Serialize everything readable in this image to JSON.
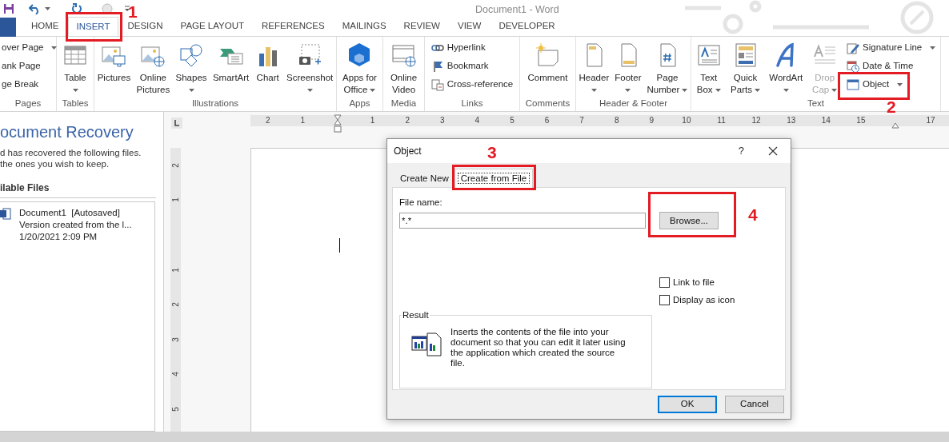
{
  "title_bar": {
    "title": "Document1 - Word"
  },
  "tabs": [
    {
      "label": "HOME",
      "selected": false
    },
    {
      "label": "INSERT",
      "selected": true
    },
    {
      "label": "DESIGN",
      "selected": false
    },
    {
      "label": "PAGE LAYOUT",
      "selected": false
    },
    {
      "label": "REFERENCES",
      "selected": false
    },
    {
      "label": "MAILINGS",
      "selected": false
    },
    {
      "label": "REVIEW",
      "selected": false
    },
    {
      "label": "VIEW",
      "selected": false
    },
    {
      "label": "DEVELOPER",
      "selected": false
    }
  ],
  "ribbon_groups": [
    {
      "label": "Pages",
      "small_buttons": [
        {
          "kind": "none",
          "label": "over Page",
          "dropdown": true,
          "disabled": false
        },
        {
          "kind": "none",
          "label": "ank Page",
          "dropdown": false,
          "disabled": false
        },
        {
          "kind": "none",
          "label": "ge Break",
          "dropdown": false,
          "disabled": false
        }
      ]
    },
    {
      "label": "Tables",
      "large_buttons": [
        {
          "kind": "table",
          "lines": [
            "Table"
          ],
          "dropdown": true,
          "disabled": false
        }
      ]
    },
    {
      "label": "Illustrations",
      "large_buttons": [
        {
          "kind": "picture",
          "lines": [
            "Pictures"
          ],
          "dropdown": false,
          "disabled": false
        },
        {
          "kind": "onlinepicture",
          "lines": [
            "Online",
            "Pictures"
          ],
          "dropdown": false,
          "disabled": false
        },
        {
          "kind": "shapes",
          "lines": [
            "Shapes"
          ],
          "dropdown": true,
          "disabled": false
        },
        {
          "kind": "smartart",
          "lines": [
            "SmartArt"
          ],
          "dropdown": false,
          "disabled": false
        },
        {
          "kind": "chart",
          "lines": [
            "Chart"
          ],
          "dropdown": false,
          "disabled": false
        },
        {
          "kind": "screenshot",
          "lines": [
            "Screenshot"
          ],
          "dropdown": true,
          "disabled": false
        }
      ]
    },
    {
      "label": "Apps",
      "large_buttons": [
        {
          "kind": "apps",
          "lines": [
            "Apps for",
            "Office"
          ],
          "dropdown": true,
          "disabled": false
        }
      ]
    },
    {
      "label": "Media",
      "large_buttons": [
        {
          "kind": "video",
          "lines": [
            "Online",
            "Video"
          ],
          "dropdown": false,
          "disabled": false
        }
      ]
    },
    {
      "label": "Links",
      "small_buttons": [
        {
          "kind": "hyperlink",
          "label": "Hyperlink",
          "dropdown": false,
          "disabled": false
        },
        {
          "kind": "bookmark",
          "label": "Bookmark",
          "dropdown": false,
          "disabled": false
        },
        {
          "kind": "crossref",
          "label": "Cross-reference",
          "dropdown": false,
          "disabled": false
        }
      ]
    },
    {
      "label": "Comments",
      "large_buttons": [
        {
          "kind": "comment",
          "lines": [
            "Comment"
          ],
          "dropdown": false,
          "disabled": false
        }
      ]
    },
    {
      "label": "Header & Footer",
      "large_buttons": [
        {
          "kind": "header",
          "lines": [
            "Header"
          ],
          "dropdown": true,
          "disabled": false
        },
        {
          "kind": "footer",
          "lines": [
            "Footer"
          ],
          "dropdown": true,
          "disabled": false
        },
        {
          "kind": "pagenumber",
          "lines": [
            "Page",
            "Number"
          ],
          "dropdown": true,
          "disabled": false
        }
      ]
    },
    {
      "label": "Text",
      "large_buttons": [
        {
          "kind": "textbox",
          "lines": [
            "Text",
            "Box"
          ],
          "dropdown": true,
          "disabled": false
        },
        {
          "kind": "quickparts",
          "lines": [
            "Quick",
            "Parts"
          ],
          "dropdown": true,
          "disabled": false
        },
        {
          "kind": "wordart",
          "lines": [
            "WordArt"
          ],
          "dropdown": true,
          "disabled": false
        },
        {
          "kind": "dropcap",
          "lines": [
            "Drop",
            "Cap"
          ],
          "dropdown": true,
          "disabled": true
        }
      ],
      "small_buttons": [
        {
          "kind": "signature",
          "label": "Signature Line",
          "dropdown": true,
          "disabled": false
        },
        {
          "kind": "datetime",
          "label": "Date & Time",
          "dropdown": false,
          "disabled": false
        },
        {
          "kind": "object",
          "label": "Object",
          "dropdown": true,
          "disabled": false
        }
      ]
    }
  ],
  "recovery_pane": {
    "title": "ocument Recovery",
    "message_lines": [
      "d has recovered the following files.",
      "the ones you wish to keep."
    ],
    "list_heading": "ilable Files",
    "files": [
      {
        "name": "Document1  [Autosaved]",
        "detail": "Version created from the l...",
        "date": "1/20/2021 2:09 PM"
      }
    ]
  },
  "horizontal_ruler": [
    {
      "kind": "number",
      "text": "2"
    },
    {
      "kind": "number",
      "text": "1"
    },
    {
      "kind": "indent"
    },
    {
      "kind": "number",
      "text": "1"
    },
    {
      "kind": "number",
      "text": "2"
    },
    {
      "kind": "number",
      "text": "3"
    },
    {
      "kind": "number",
      "text": "4"
    },
    {
      "kind": "number",
      "text": "5"
    },
    {
      "kind": "number",
      "text": "6"
    },
    {
      "kind": "number",
      "text": "7"
    },
    {
      "kind": "number",
      "text": "8"
    },
    {
      "kind": "number",
      "text": "9"
    },
    {
      "kind": "number",
      "text": "10"
    },
    {
      "kind": "number",
      "text": "11"
    },
    {
      "kind": "number",
      "text": "12"
    },
    {
      "kind": "number",
      "text": "13"
    },
    {
      "kind": "number",
      "text": "14"
    },
    {
      "kind": "number",
      "text": "15"
    },
    {
      "kind": "rightindent"
    },
    {
      "kind": "number",
      "text": "17"
    }
  ],
  "vertical_ruler": [
    {
      "kind": "number",
      "text": "2"
    },
    {
      "kind": "number",
      "text": "1"
    },
    {
      "kind": "margin"
    },
    {
      "kind": "number",
      "text": "1"
    },
    {
      "kind": "number",
      "text": "2"
    },
    {
      "kind": "number",
      "text": "3"
    },
    {
      "kind": "number",
      "text": "4"
    },
    {
      "kind": "number",
      "text": "5"
    }
  ],
  "dialog": {
    "title": "Object",
    "help": "?",
    "tabs": [
      {
        "label": "Create New",
        "selected": false
      },
      {
        "label": "Create from File",
        "selected": true
      }
    ],
    "file_name": {
      "label": "File name:",
      "value": "*.*"
    },
    "browse_button": "Browse...",
    "checkboxes": [
      {
        "label": "Link to file",
        "checked": false
      },
      {
        "label": "Display as icon",
        "checked": false
      }
    ],
    "result": {
      "heading": "Result",
      "text": "Inserts the contents of the file into your document so that you can edit it later using the application which created the source file."
    },
    "buttons": [
      {
        "label": "OK",
        "default": true
      },
      {
        "label": "Cancel",
        "default": false
      }
    ]
  },
  "annotations": [
    {
      "label": "1"
    },
    {
      "label": "2"
    },
    {
      "label": "3"
    },
    {
      "label": "4"
    }
  ]
}
